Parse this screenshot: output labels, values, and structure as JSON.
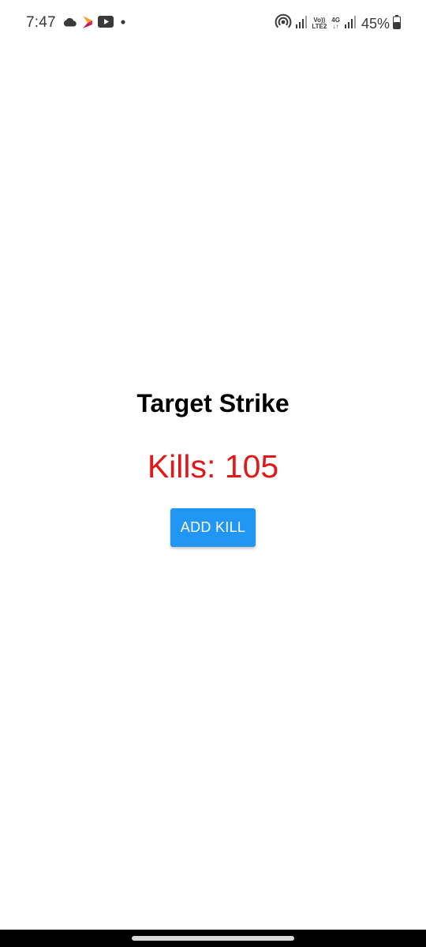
{
  "status_bar": {
    "time": "7:47",
    "left_icons": [
      "cloud-icon",
      "app-logo-icon",
      "youtube-icon",
      "notification-dot-icon"
    ],
    "right_icons": [
      "hotspot-icon",
      "signal-1-icon",
      "volte-icon",
      "signal-2-icon",
      "battery-icon"
    ],
    "volte_top": "Vo))",
    "volte_bottom": "LTE2",
    "network_type": "4G",
    "battery_percent": "45%"
  },
  "app": {
    "title": "Target Strike",
    "kills_text": "Kills: 105",
    "add_kill_label": "ADD KILL",
    "colors": {
      "kills": "#e21818",
      "button": "#2196f3",
      "button_text": "#ffffff"
    }
  }
}
